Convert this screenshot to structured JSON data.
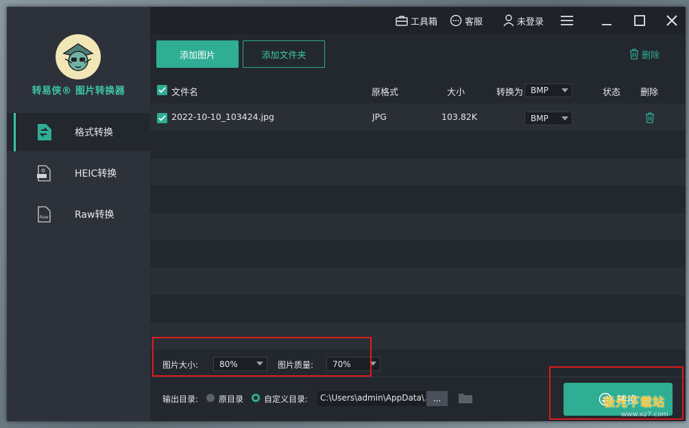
{
  "app": {
    "brand": "转易侠® 图片转换器"
  },
  "topbar": {
    "toolbox": "工具箱",
    "support": "客服",
    "login": "未登录"
  },
  "sidebar": {
    "items": [
      {
        "label": "格式转换",
        "icon": "format-convert-icon",
        "active": true
      },
      {
        "label": "HEIC转换",
        "icon": "heic-file-icon",
        "active": false
      },
      {
        "label": "Raw转换",
        "icon": "raw-file-icon",
        "active": false
      }
    ]
  },
  "toolbar": {
    "add_images": "添加图片",
    "add_folder": "添加文件夹",
    "delete_all": "删除"
  },
  "table": {
    "headers": {
      "filename": "文件名",
      "original_format": "原格式",
      "size": "大小",
      "convert_to": "转换为",
      "status": "状态",
      "delete": "删除"
    },
    "global_format": "BMP",
    "rows": [
      {
        "filename": "2022-10-10_103424.jpg",
        "format": "JPG",
        "size": "103.82K",
        "target": "BMP",
        "checked": true
      }
    ]
  },
  "options": {
    "size_label": "图片大小:",
    "size_value": "80%",
    "quality_label": "图片质量:",
    "quality_value": "70%"
  },
  "output": {
    "label": "输出目录:",
    "original_dir": "原目录",
    "custom_dir": "自定义目录:",
    "path": "C:\\Users\\admin\\AppData\\...",
    "browse": "..."
  },
  "convert_button": "转换",
  "watermark": {
    "text": "极光下载站",
    "url": "www.xz7.com"
  },
  "colors": {
    "accent": "#2fae94",
    "highlight_box": "#e11b1b"
  }
}
